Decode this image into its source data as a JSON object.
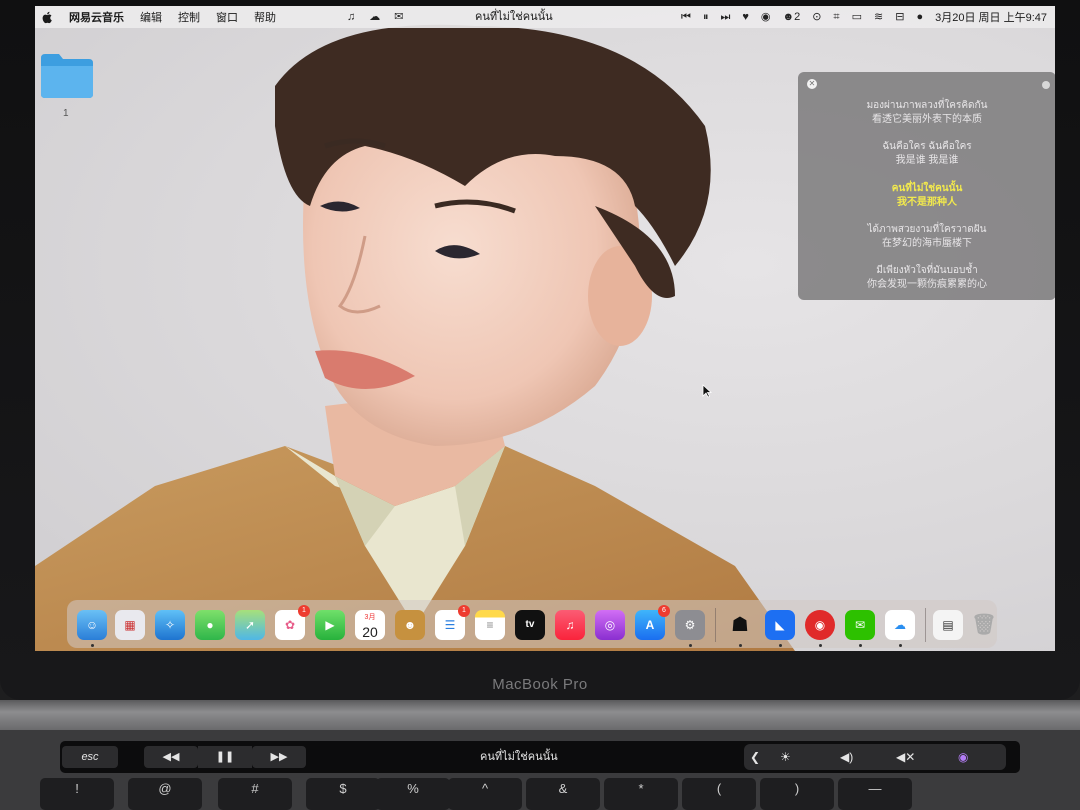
{
  "menubar": {
    "app_name": "网易云音乐",
    "menus": [
      "编辑",
      "控制",
      "窗口",
      "帮助"
    ],
    "now_playing": "คนที่ไม่ใช่คนนั้น",
    "notification_count": "2",
    "clock": "3月20日 周日 上午9:47"
  },
  "desktop": {
    "folder_label": "1"
  },
  "lyrics": {
    "lines": [
      {
        "thai": "มองผ่านภาพลวงที่ใครคิดกัน",
        "zh": "看透它美丽外表下的本质"
      },
      {
        "thai": "ฉันคือใคร ฉันคือใคร",
        "zh": "我是谁 我是谁"
      },
      {
        "thai": "คนที่ไม่ใช่คนนั้น",
        "zh": "我不是那种人"
      },
      {
        "thai": "ได้ภาพสวยงามที่ใครวาดฝัน",
        "zh": "在梦幻的海市蜃楼下"
      },
      {
        "thai": "มีเพียงหัวใจที่มันบอบช้ำ",
        "zh": "你会发现一颗伤痕累累的心"
      }
    ],
    "highlight_color": "#f2e94d"
  },
  "dock": {
    "calendar_month": "3月",
    "calendar_day": "20",
    "badges": {
      "photos": "1",
      "reminders": "1",
      "appstore": "6"
    },
    "tv_label": "tv"
  },
  "laptop": {
    "brand": "MacBook Pro"
  },
  "touchbar": {
    "esc": "esc",
    "title": "คนที่ไม่ใช่คนนั้น"
  },
  "keys": [
    "!",
    "@",
    "#",
    "$",
    "%",
    "^",
    "&",
    "*",
    "(",
    ")",
    "—"
  ]
}
